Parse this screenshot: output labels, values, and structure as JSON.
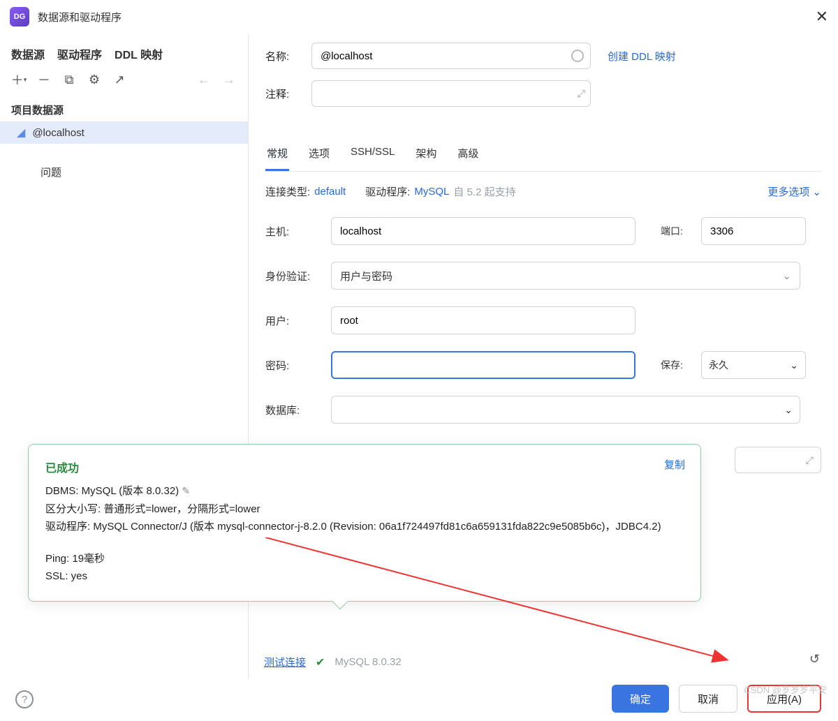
{
  "title": "数据源和驱动程序",
  "sidebar": {
    "tabs": [
      "数据源",
      "驱动程序",
      "DDL 映射"
    ],
    "section_project": "项目数据源",
    "item0": "@localhost",
    "problem": "问题"
  },
  "fields": {
    "name_label": "名称:",
    "name_value": "@localhost",
    "ddl_link": "创建 DDL 映射",
    "comment_label": "注释:"
  },
  "tabs": {
    "t0": "常规",
    "t1": "选项",
    "t2": "SSH/SSL",
    "t3": "架构",
    "t4": "高级"
  },
  "conn": {
    "conn_type_label": "连接类型:",
    "conn_type_value": "default",
    "driver_label": "驱动程序:",
    "driver_value": "MySQL",
    "driver_note": "自 5.2 起支持",
    "more": "更多选项"
  },
  "form": {
    "host_label": "主机:",
    "host_value": "localhost",
    "port_label": "端口:",
    "port_value": "3306",
    "auth_label": "身份验证:",
    "auth_value": "用户与密码",
    "user_label": "用户:",
    "user_value": "root",
    "pwd_label": "密码:",
    "pwd_value": "",
    "save_label": "保存:",
    "save_value": "永久",
    "db_label": "数据库:"
  },
  "success": {
    "title": "已成功",
    "copy": "复制",
    "line1a": "DBMS: MySQL (版本 8.0.32)",
    "line2": "区分大小写: 普通形式=lower，分隔形式=lower",
    "line3": "驱动程序: MySQL Connector/J (版本 mysql-connector-j-8.2.0 (Revision: 06a1f724497fd81c6a659131fda822c9e5085b6c)，JDBC4.2)",
    "line4": "Ping: 19毫秒",
    "line5": "SSL: yes"
  },
  "status": {
    "test": "测试连接",
    "ver": "MySQL 8.0.32"
  },
  "buttons": {
    "ok": "确定",
    "cancel": "取消",
    "apply": "应用(A)"
  },
  "watermark": "CSDN @岁岁岁平安"
}
